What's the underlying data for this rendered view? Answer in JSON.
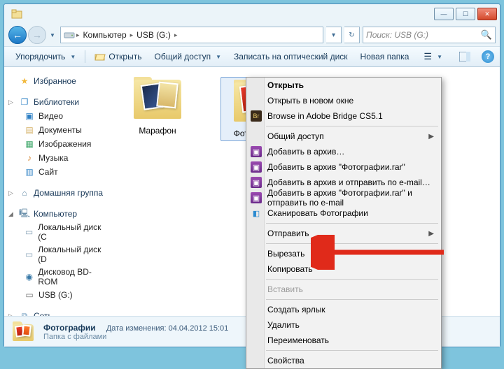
{
  "breadcrumb": {
    "item0": "Компьютер",
    "item1": "USB (G:)"
  },
  "search": {
    "placeholder": "Поиск: USB (G:)"
  },
  "toolbar": {
    "organize": "Упорядочить",
    "open": "Открыть",
    "share": "Общий доступ",
    "burn": "Записать на оптический диск",
    "newfolder": "Новая папка"
  },
  "nav": {
    "favorites": "Избранное",
    "libraries": "Библиотеки",
    "video": "Видео",
    "documents": "Документы",
    "pictures": "Изображения",
    "music": "Музыка",
    "site": "Сайт",
    "homegroup": "Домашняя группа",
    "computer": "Компьютер",
    "local_c": "Локальный диск (C",
    "local_d": "Локальный диск (D",
    "bdrom": "Дисковод BD-ROM",
    "usb": "USB (G:)",
    "network": "Сеть"
  },
  "items": {
    "folder1": "Марафон",
    "folder2": "Фотографии"
  },
  "ctx": {
    "open": "Открыть",
    "open_new": "Открыть в новом окне",
    "bridge": "Browse in Adobe Bridge CS5.1",
    "share": "Общий доступ",
    "add_archive": "Добавить в архив…",
    "add_rar": "Добавить в архив \"Фотографии.rar\"",
    "add_email": "Добавить в архив и отправить по e-mail…",
    "add_rar_email": "Добавить в архив \"Фотографии.rar\" и отправить по e-mail",
    "scan": "Сканировать Фотографии",
    "sendto": "Отправить",
    "cut": "Вырезать",
    "copy": "Копировать",
    "paste": "Вставить",
    "shortcut": "Создать ярлык",
    "delete": "Удалить",
    "rename": "Переименовать",
    "properties": "Свойства"
  },
  "status": {
    "name": "Фотографии",
    "type": "Папка с файлами",
    "mod_label": "Дата изменения:",
    "mod_value": "04.04.2012 15:01"
  }
}
